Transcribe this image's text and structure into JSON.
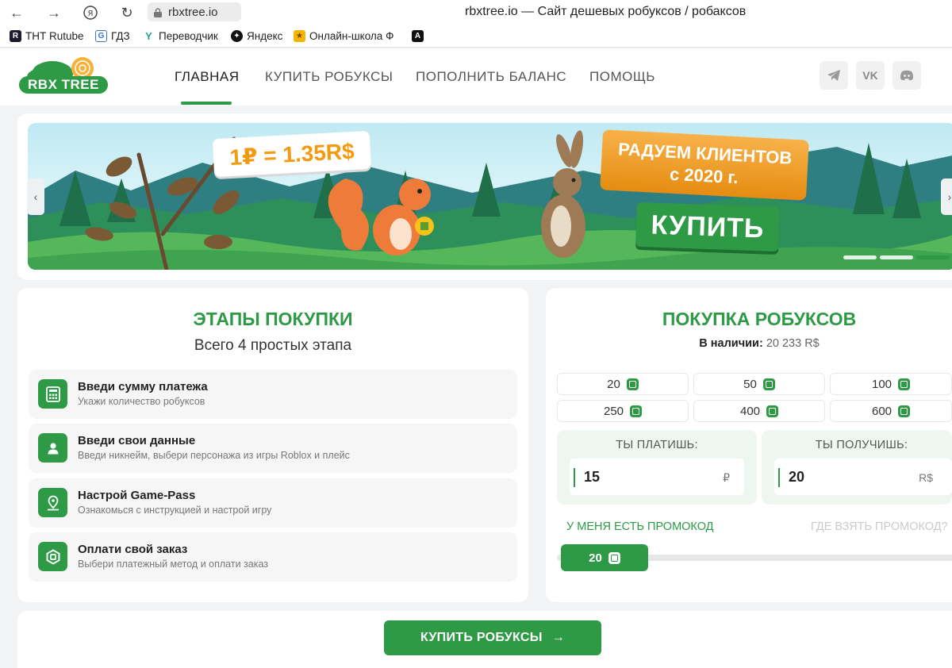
{
  "browser": {
    "url": "rbxtree.io",
    "tab_title": "rbxtree.io — Сайт дешевых робуксов / робаксов",
    "bookmarks": [
      {
        "label": "ТНТ Rutube",
        "icon": "rutube-icon"
      },
      {
        "label": "ГДЗ",
        "icon": "gdz-icon"
      },
      {
        "label": "Переводчик",
        "icon": "translate-icon"
      },
      {
        "label": "Яндекс",
        "icon": "yandex-icon"
      },
      {
        "label": "Онлайн-школа Ф",
        "icon": "school-icon"
      },
      {
        "label": "",
        "icon": "a-icon"
      }
    ]
  },
  "header": {
    "logo_text": "RBX TREE",
    "nav": [
      {
        "label": "Главная",
        "active": true
      },
      {
        "label": "Купить робуксы",
        "active": false
      },
      {
        "label": "Пополнить баланс",
        "active": false
      },
      {
        "label": "Помощь",
        "active": false
      }
    ],
    "social": [
      "telegram-icon",
      "vk-icon",
      "discord-icon"
    ],
    "social_vk_text": "VK"
  },
  "banner": {
    "price": "1₽ = 1.35R$",
    "promo_line1": "РАДУЕМ КЛИЕНТОВ",
    "promo_line2": "с 2020 г.",
    "buy_label": "КУПИТЬ",
    "slides_total": 3,
    "active_slide": 3
  },
  "steps_card": {
    "title": "Этапы покупки",
    "subtitle": "Всего 4 простых этапа",
    "steps": [
      {
        "title": "Введи сумму платежа",
        "subtitle": "Укажи количество робуксов",
        "icon": "calculator-icon"
      },
      {
        "title": "Введи свои данные",
        "subtitle": "Введи никнейм, выбери персонажа из игры Roblox и плейс",
        "icon": "user-icon"
      },
      {
        "title": "Настрой Game-Pass",
        "subtitle": "Ознакомься с инструкцией и настрой игру",
        "icon": "location-pin-icon"
      },
      {
        "title": "Оплати свой заказ",
        "subtitle": "Выбери платежный метод и оплати заказ",
        "icon": "robux-icon"
      }
    ]
  },
  "purchase_card": {
    "title": "Покупка робуксов",
    "stock_label": "В наличии:",
    "stock_value": "20 233 R$",
    "amounts": [
      "20",
      "50",
      "100",
      "250",
      "400",
      "600"
    ],
    "you_pay_label": "Ты платишь:",
    "you_pay_value": "15",
    "you_pay_unit": "₽",
    "you_get_label": "Ты получишь:",
    "you_get_value": "20",
    "you_get_unit": "R$",
    "promo_have": "У меня есть промокод",
    "promo_where": "Где взять промокод?",
    "slider_value": "20",
    "accent": "#2e9a46"
  },
  "footer": {
    "buy_button": "Купить робуксы",
    "arrow": "→"
  }
}
